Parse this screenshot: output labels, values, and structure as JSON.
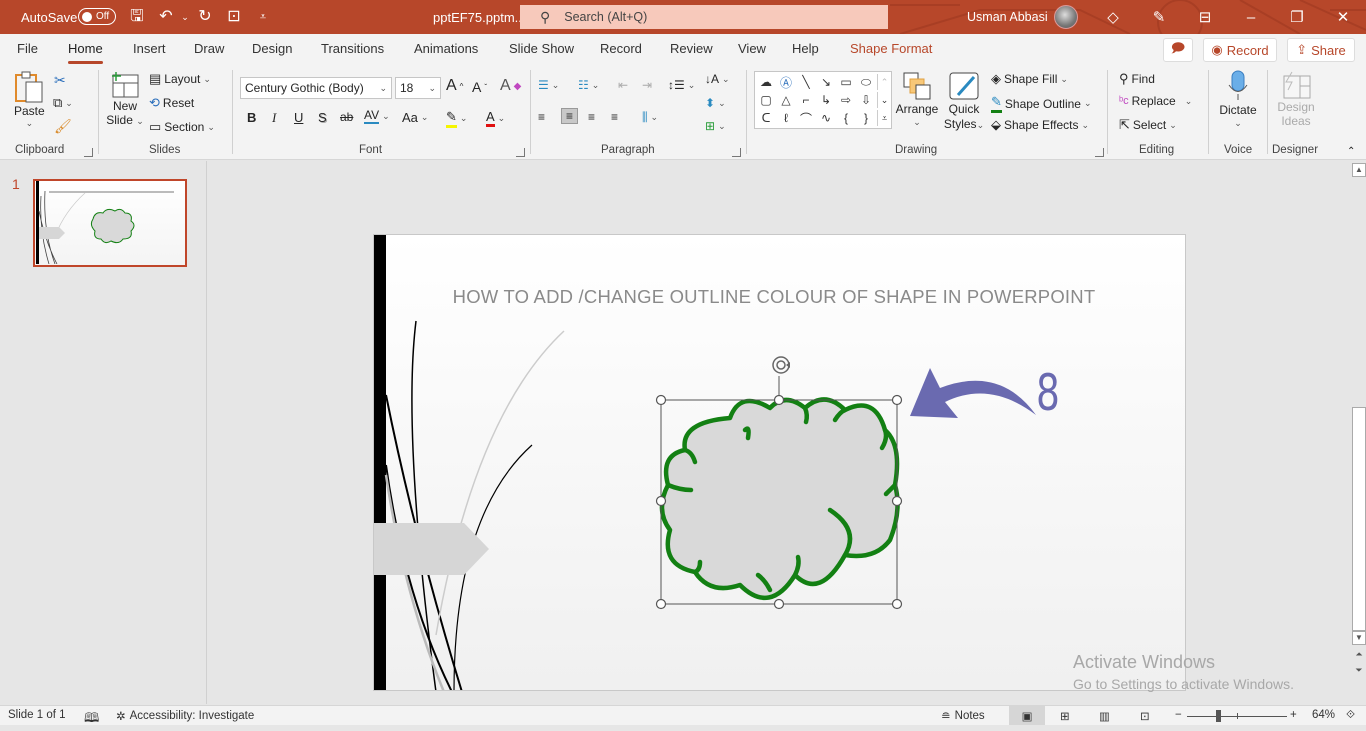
{
  "titlebar": {
    "autosave_label": "AutoSave",
    "autosave_state": "Off",
    "filename": "pptEF75.pptm...",
    "search_placeholder": "Search (Alt+Q)",
    "user_name": "Usman Abbasi",
    "accent_color": "#b7472a"
  },
  "menu": {
    "tabs": [
      "File",
      "Home",
      "Insert",
      "Draw",
      "Design",
      "Transitions",
      "Animations",
      "Slide Show",
      "Record",
      "Review",
      "View",
      "Help",
      "Shape Format"
    ],
    "active_tab": "Home",
    "record_label": "Record",
    "share_label": "Share"
  },
  "ribbon": {
    "clipboard": {
      "label": "Clipboard",
      "paste": "Paste"
    },
    "slides": {
      "label": "Slides",
      "new_slide_1": "New",
      "new_slide_2": "Slide",
      "layout": "Layout",
      "reset": "Reset",
      "section": "Section"
    },
    "font": {
      "label": "Font",
      "font_name": "Century Gothic (Body)",
      "font_size": "18",
      "bold": "B",
      "italic": "I",
      "underline": "U",
      "shadow": "S",
      "strike": "ab",
      "spacing": "AV",
      "case": "Aa"
    },
    "paragraph": {
      "label": "Paragraph"
    },
    "drawing": {
      "label": "Drawing",
      "arrange": "Arrange",
      "quick_styles_1": "Quick",
      "quick_styles_2": "Styles",
      "shape_fill": "Shape Fill",
      "shape_outline": "Shape Outline",
      "shape_effects": "Shape Effects"
    },
    "editing": {
      "label": "Editing",
      "find": "Find",
      "replace": "Replace",
      "select": "Select"
    },
    "voice": {
      "label": "Voice",
      "dictate": "Dictate"
    },
    "designer": {
      "label": "Designer",
      "design_ideas_1": "Design",
      "design_ideas_2": "Ideas"
    }
  },
  "thumbnails": [
    {
      "number": "1"
    }
  ],
  "slide": {
    "title": "HOW TO ADD /CHANGE OUTLINE COLOUR OF SHAPE IN POWERPOINT",
    "step_number": "8",
    "cloud_outline_color": "#138013",
    "cloud_fill_color": "#d9d9d9",
    "arrow_color": "#6a6ab0"
  },
  "status": {
    "slide_info": "Slide 1 of 1",
    "accessibility": "Accessibility: Investigate",
    "notes": "Notes",
    "zoom": "64%"
  },
  "watermark": {
    "line1": "Activate Windows",
    "line2": "Go to Settings to activate Windows."
  }
}
